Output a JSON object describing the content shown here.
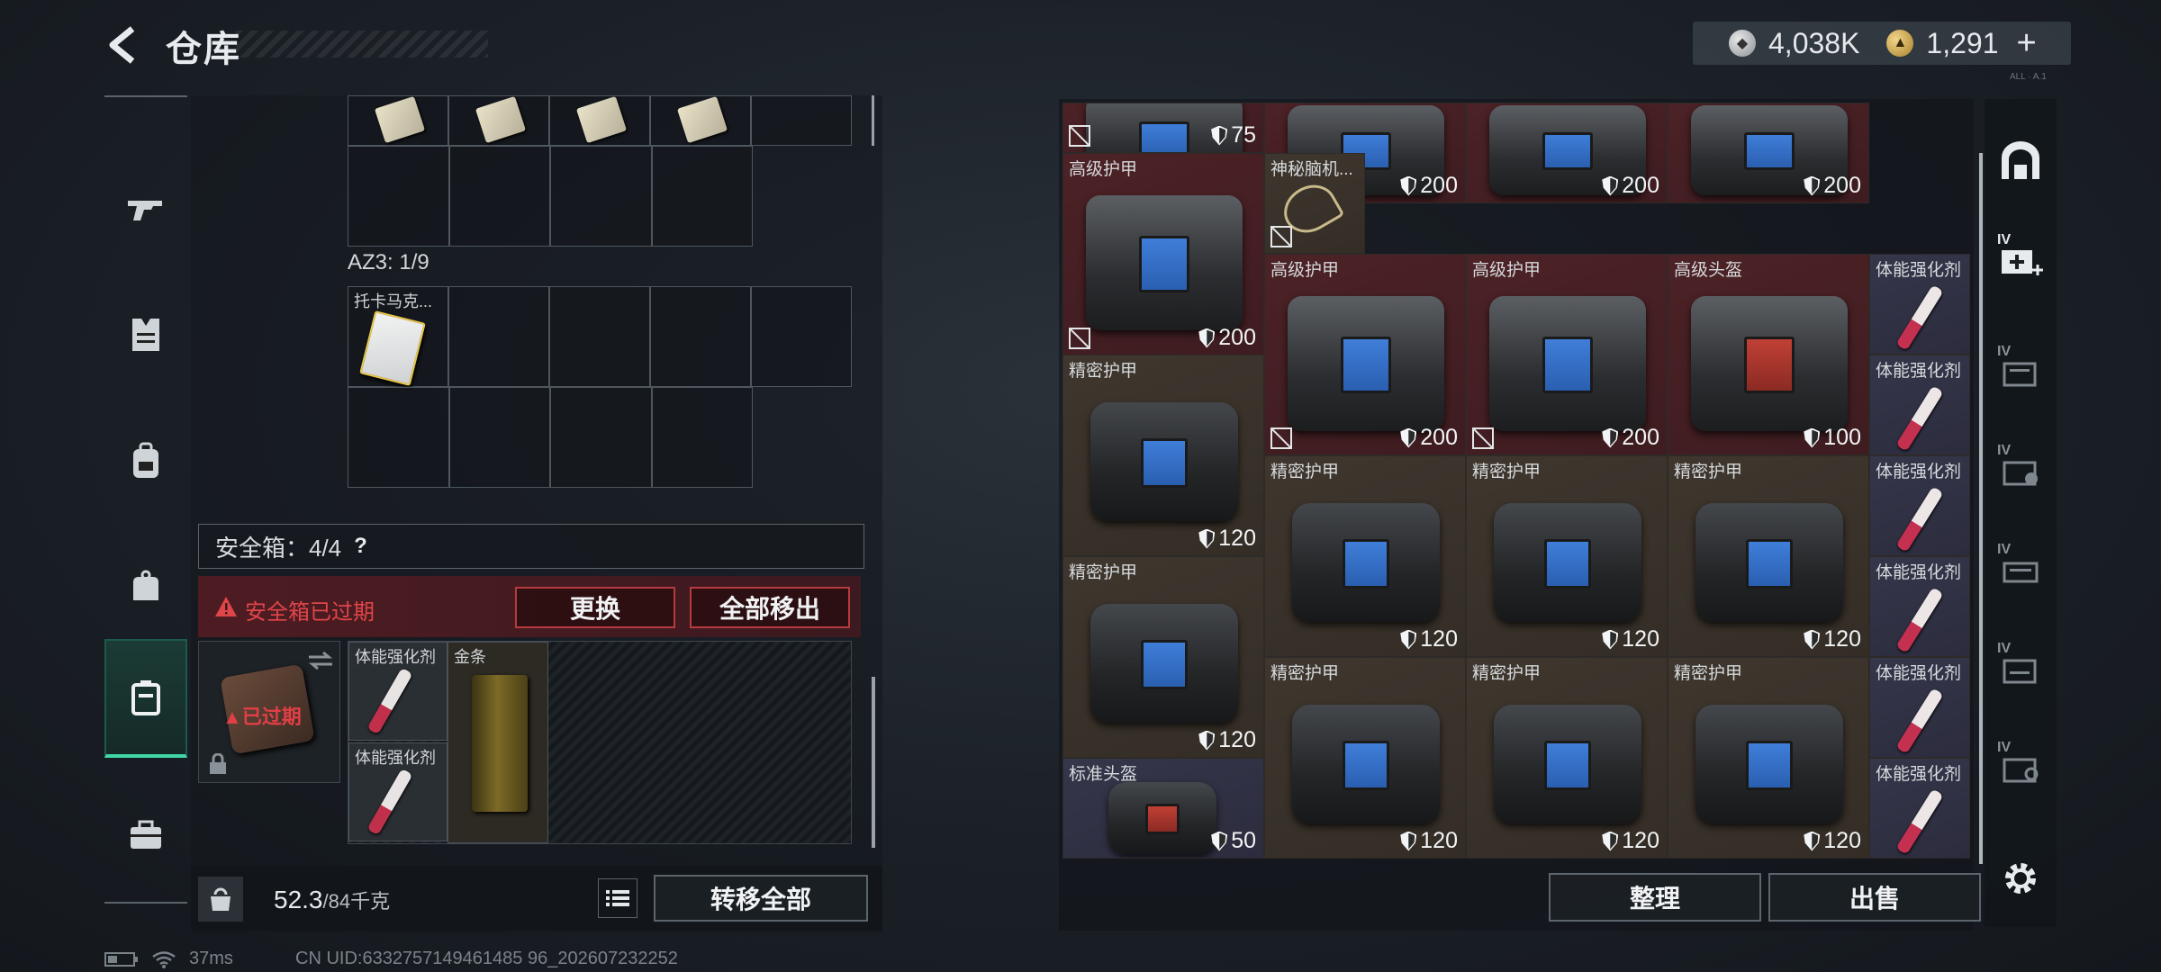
{
  "header": {
    "title": "仓库",
    "currency_silver": "4,038K",
    "currency_gold": "1,291",
    "plus": "+",
    "silver_icon": "silver-coin-icon",
    "gold_icon": "gold-coin-icon"
  },
  "left_nav": {
    "items": [
      {
        "icon": "gun-icon",
        "active": false
      },
      {
        "icon": "vest-icon",
        "active": false
      },
      {
        "icon": "backpack-icon",
        "active": false
      },
      {
        "icon": "bag-icon",
        "active": false
      },
      {
        "icon": "safe-case-icon",
        "active": true
      },
      {
        "icon": "toolbox-icon",
        "active": false
      }
    ]
  },
  "container": {
    "az3_label": "AZ3: 1/9",
    "az3_item": "托卡马克..."
  },
  "safebox": {
    "label": "安全箱：4/4",
    "help": "?",
    "expired_message": "安全箱已过期",
    "replace_button": "更换",
    "remove_all_button": "全部移出",
    "case_status": "已过期",
    "items": [
      {
        "name": "体能强化剂"
      },
      {
        "name": "金条"
      },
      {
        "name": "体能强化剂"
      }
    ]
  },
  "footer_left": {
    "weight_current": "52.3",
    "weight_max": "/84千克",
    "transfer_all_button": "转移全部"
  },
  "inventory": {
    "tiles": [
      {
        "name": "",
        "durability": "75",
        "color": "red"
      },
      {
        "name": "",
        "durability": "200",
        "color": "red"
      },
      {
        "name": "",
        "durability": "200",
        "color": "red"
      },
      {
        "name": "",
        "durability": "200",
        "color": "red"
      },
      {
        "name": "高级护甲",
        "durability": "200",
        "color": "red"
      },
      {
        "name": "神秘脑机...",
        "durability": "",
        "color": "brown"
      },
      {
        "name": "高级护甲",
        "durability": "200",
        "color": "red"
      },
      {
        "name": "高级护甲",
        "durability": "200",
        "color": "red"
      },
      {
        "name": "高级头盔",
        "durability": "100",
        "color": "red"
      },
      {
        "name": "体能强化剂",
        "durability": "",
        "color": "purple"
      },
      {
        "name": "精密护甲",
        "durability": "120",
        "color": "brown"
      },
      {
        "name": "体能强化剂",
        "durability": "",
        "color": "purple"
      },
      {
        "name": "精密护甲",
        "durability": "120",
        "color": "brown"
      },
      {
        "name": "精密护甲",
        "durability": "120",
        "color": "brown"
      },
      {
        "name": "精密护甲",
        "durability": "120",
        "color": "brown"
      },
      {
        "name": "体能强化剂",
        "durability": "",
        "color": "purple"
      },
      {
        "name": "精密护甲",
        "durability": "120",
        "color": "brown"
      },
      {
        "name": "体能强化剂",
        "durability": "",
        "color": "purple"
      },
      {
        "name": "精密护甲",
        "durability": "120",
        "color": "brown"
      },
      {
        "name": "精密护甲",
        "durability": "120",
        "color": "brown"
      },
      {
        "name": "精密护甲",
        "durability": "120",
        "color": "brown"
      },
      {
        "name": "体能强化剂",
        "durability": "",
        "color": "purple"
      },
      {
        "name": "标准头盔",
        "durability": "50",
        "color": "purple"
      },
      {
        "name": "体能强化剂",
        "durability": "",
        "color": "purple"
      }
    ],
    "sort_button": "整理",
    "sell_button": "出售"
  },
  "right_sidebar": {
    "icons": [
      "storage-arch-icon",
      "add-storage-iv-icon",
      "storage-iv-icon",
      "storage-iv-icon-2",
      "storage-iv-icon-3",
      "storage-iv-icon-4",
      "storage-iv-icon-5",
      "settings-gear-icon"
    ],
    "badge": "IV"
  },
  "status": {
    "ping": "37ms",
    "uid": "CN UID:6332757149461485 96_202607232252"
  }
}
